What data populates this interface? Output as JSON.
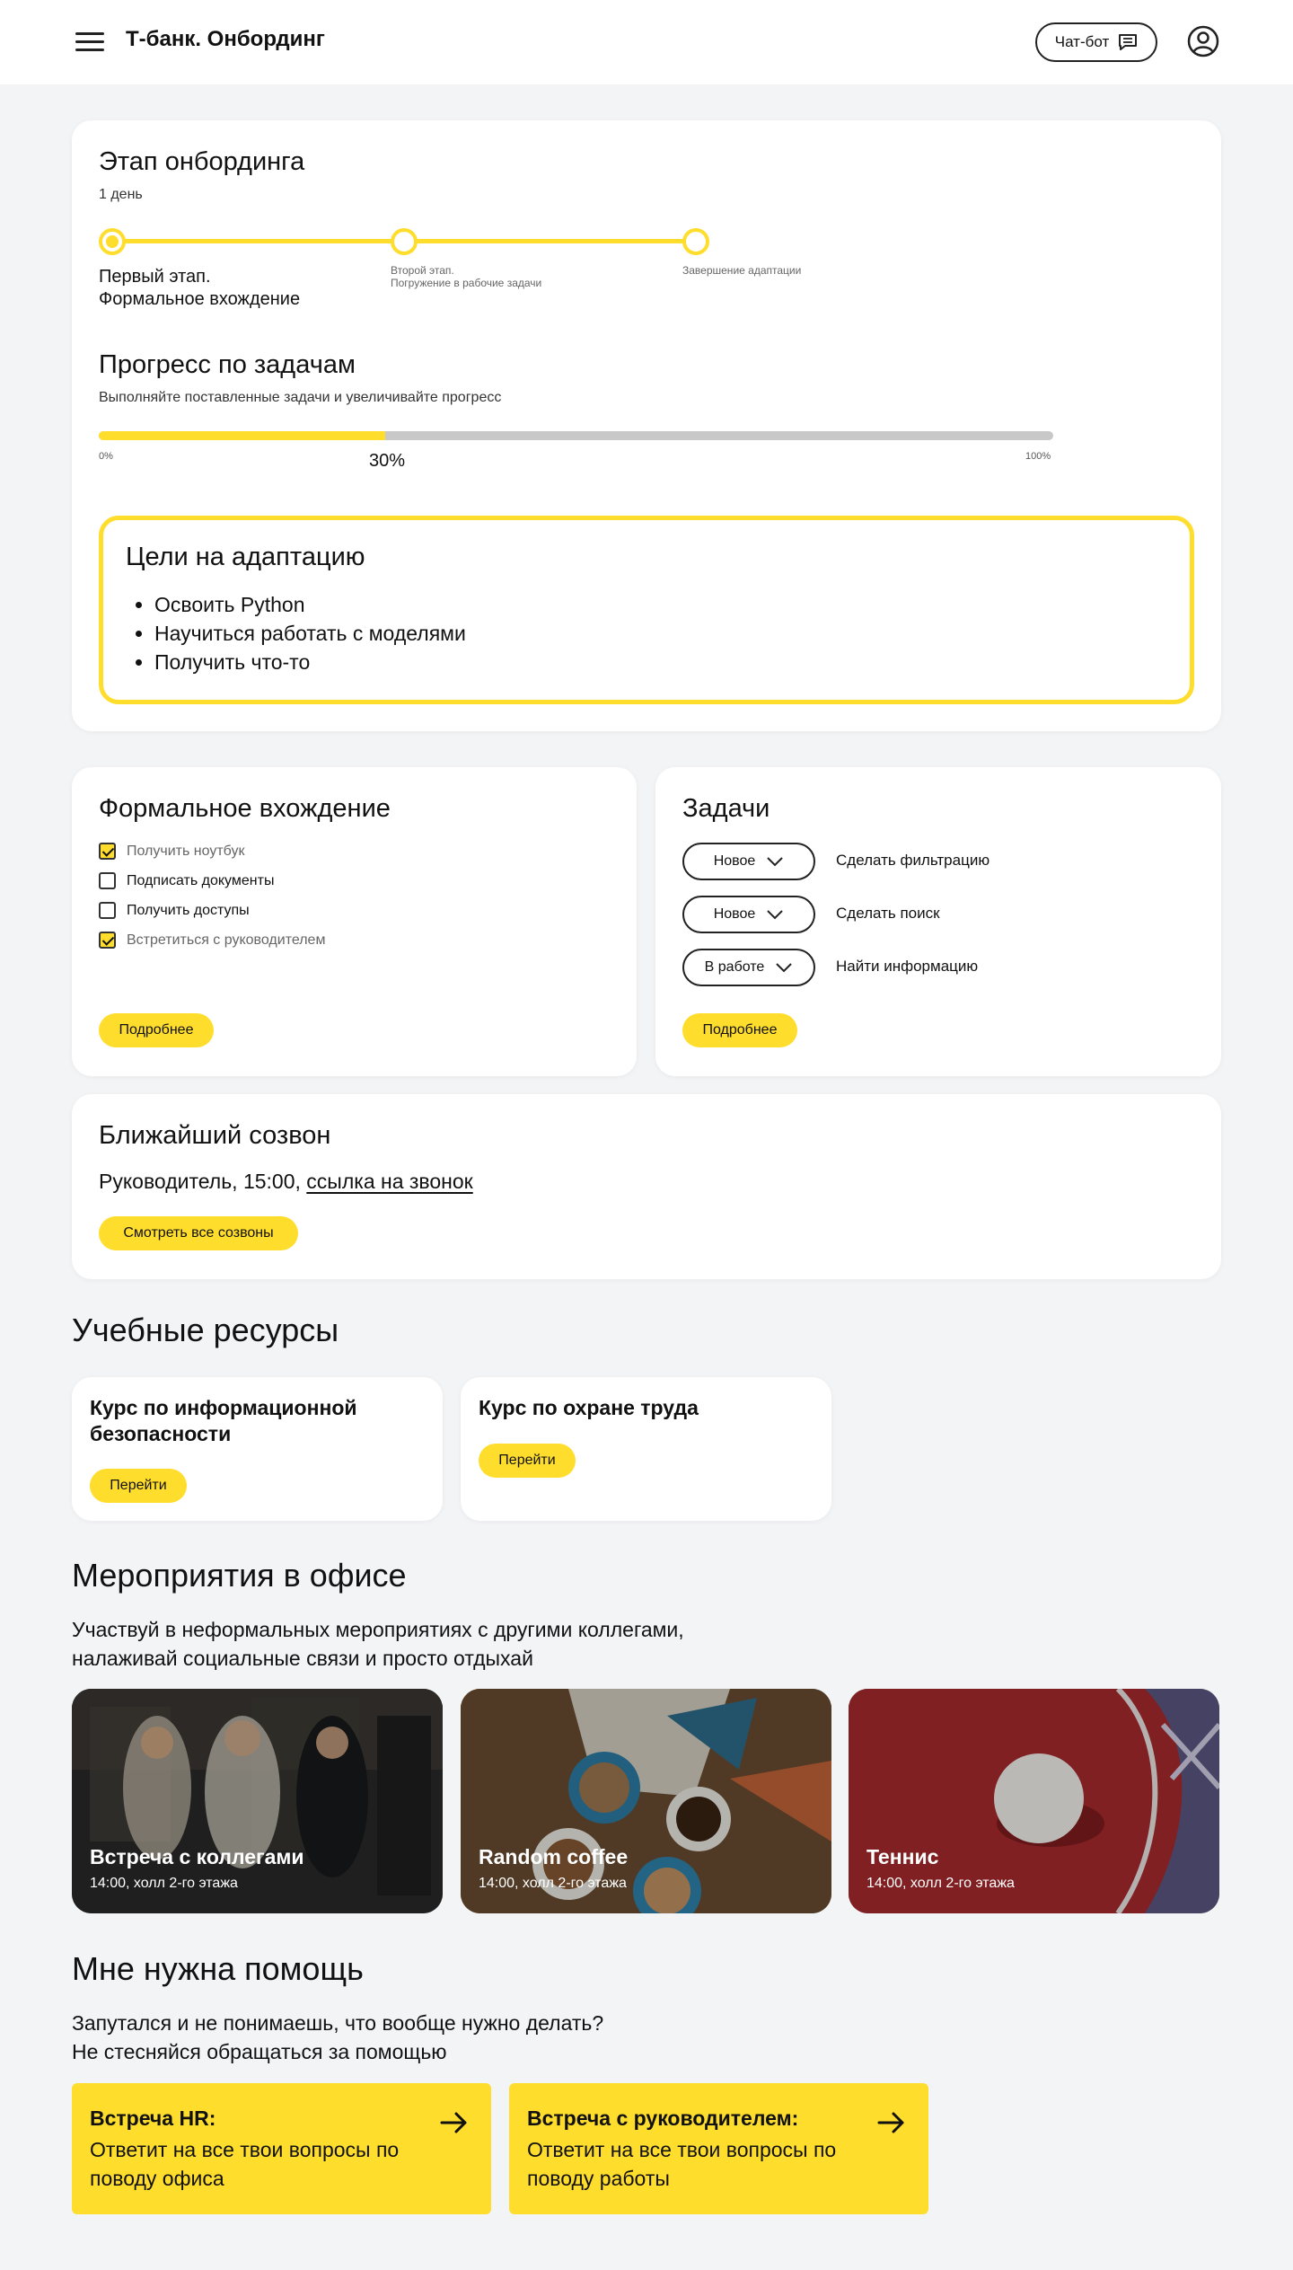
{
  "header": {
    "app_title": "Т-банк. Онбординг",
    "chat_label": "Чат-бот"
  },
  "stage": {
    "title": "Этап онбординга",
    "day": "1 день",
    "steps": [
      {
        "line1": "Первый этап.",
        "line2": "Формальное вхождение",
        "active": true
      },
      {
        "line1": "Второй этап.",
        "line2": "Погружение в рабочие задачи",
        "active": false
      },
      {
        "line1": "Завершение адаптации",
        "line2": "",
        "active": false
      }
    ]
  },
  "progress": {
    "title": "Прогресс по задачам",
    "subtitle": "Выполняйте поставленные задачи и увеличивайте прогресс",
    "value": 30,
    "value_label": "30%",
    "min_label": "0%",
    "max_label": "100%"
  },
  "goals": {
    "title": "Цели на адаптацию",
    "items": [
      "Освоить Python",
      "Научиться работать с моделями",
      "Получить что-то"
    ]
  },
  "formal": {
    "title": "Формальное вхождение",
    "items": [
      {
        "label": "Получить ноутбук",
        "checked": true
      },
      {
        "label": "Подписать документы",
        "checked": false
      },
      {
        "label": "Получить доступы",
        "checked": false
      },
      {
        "label": "Встретиться с руководителем",
        "checked": true
      }
    ],
    "more_label": "Подробнее"
  },
  "tasks": {
    "title": "Задачи",
    "items": [
      {
        "status": "Новое",
        "text": "Сделать фильтрацию"
      },
      {
        "status": "Новое",
        "text": "Сделать поиск"
      },
      {
        "status": "В работе",
        "text": "Найти информацию"
      }
    ],
    "more_label": "Подробнее"
  },
  "call": {
    "title": "Ближайший созвон",
    "text": "Руководитель, 15:00, ",
    "link": "ссылка на звонок",
    "all_label": "Смотреть все созвоны"
  },
  "resources": {
    "title": "Учебные ресурсы",
    "items": [
      {
        "title": "Курс по информационной безопасности",
        "button": "Перейти"
      },
      {
        "title": "Курс по охране труда",
        "button": "Перейти"
      }
    ]
  },
  "events": {
    "title": "Мероприятия в офисе",
    "subtitle_line1": "Участвуй в неформальных мероприятиях с другими коллегами,",
    "subtitle_line2": "налаживай социальные связи и просто отдыхай",
    "items": [
      {
        "title": "Встреча с коллегами",
        "info": "14:00, холл 2-го этажа"
      },
      {
        "title": "Random coffee",
        "info": "14:00, холл 2-го этажа"
      },
      {
        "title": "Теннис",
        "info": "14:00, холл 2-го этажа"
      }
    ]
  },
  "help": {
    "title": "Мне нужна помощь",
    "subtitle_line1": "Запутался и не понимаешь, что вообще нужно делать?",
    "subtitle_line2": "Не стесняйся обращаться за помощью",
    "items": [
      {
        "title": "Встреча HR:",
        "desc": "Ответит на все твои вопросы по поводу офиса"
      },
      {
        "title": "Встреча с руководителем:",
        "desc": "Ответит на все твои вопросы по поводу работы"
      }
    ]
  },
  "colors": {
    "accent": "#ffdd2d",
    "background": "#f3f4f6",
    "track": "#c8c8c8"
  }
}
